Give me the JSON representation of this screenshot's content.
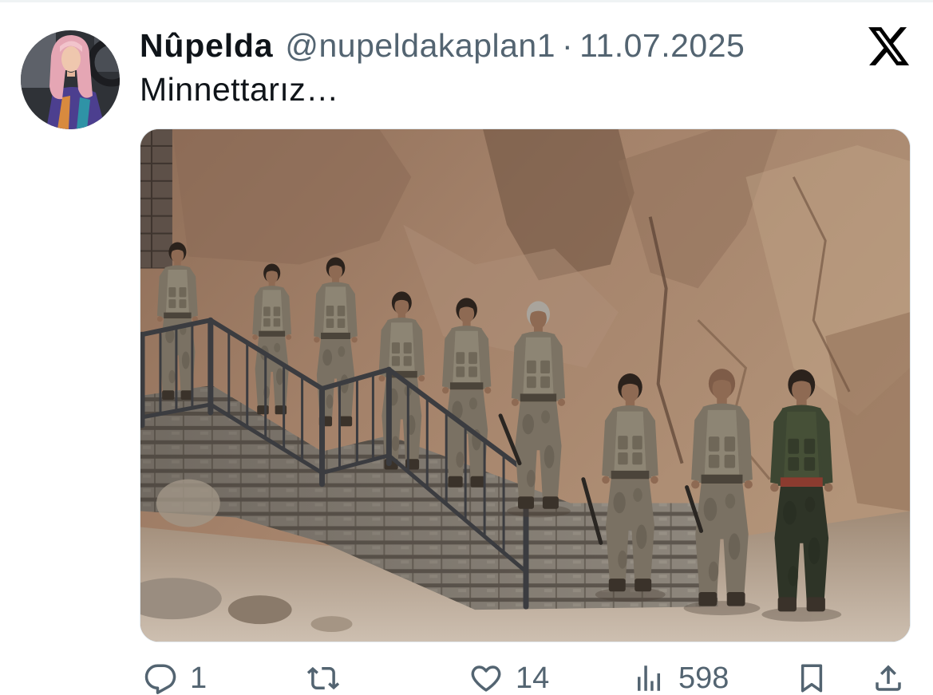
{
  "tweet": {
    "author": {
      "display_name": "Nûpelda",
      "handle": "@nupeldakaplan1",
      "separator": "·",
      "date": "11.07.2025"
    },
    "text": "Minnettarız…"
  },
  "brand": {
    "logo_icon": "x-logo-icon"
  },
  "actions": {
    "reply": {
      "icon": "reply-icon",
      "count": "1"
    },
    "repost": {
      "icon": "repost-icon"
    },
    "like": {
      "icon": "heart-icon",
      "count": "14"
    },
    "views": {
      "icon": "views-icon",
      "count": "598"
    },
    "bookmark": {
      "icon": "bookmark-icon"
    },
    "share": {
      "icon": "share-icon"
    }
  },
  "colors": {
    "text": "#0f1419",
    "secondary_text": "#536471",
    "background": "#ffffff",
    "divider": "#eff3f4"
  }
}
